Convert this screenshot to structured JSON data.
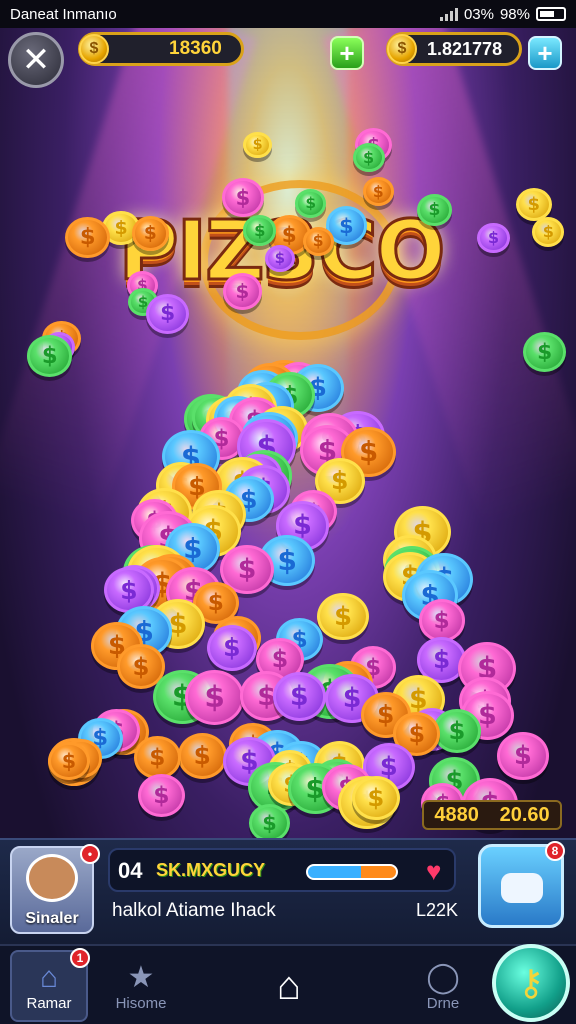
{
  "status_bar": {
    "carrier": "Daneat Inmanıo",
    "battery_pct": "03%",
    "signal_pct": "98%"
  },
  "top_bar": {
    "balance_left": "18360",
    "balance_right": "1.821778",
    "close_symbol": "✕",
    "plus_symbol": "+"
  },
  "logo": {
    "text": "PIZ3CO"
  },
  "pile_value": {
    "left": "4880",
    "right": "20.60"
  },
  "panel": {
    "avatar_label": "Sinaler",
    "level": "04",
    "bar_label": "SK.MXGUCY",
    "subtitle": "halkol Atiame Ihack",
    "count": "L22K"
  },
  "nav": {
    "items": [
      {
        "label": "Ramar",
        "icon": "home-icon"
      },
      {
        "label": "Hisome",
        "icon": "star-icon"
      },
      {
        "label": "",
        "icon": "house-outline-icon"
      },
      {
        "label": "Drne",
        "icon": "ring-icon"
      }
    ],
    "badge_1": "1",
    "fab_icon": "key-icon"
  },
  "badges": {
    "avatar": "•",
    "chest": "8"
  }
}
